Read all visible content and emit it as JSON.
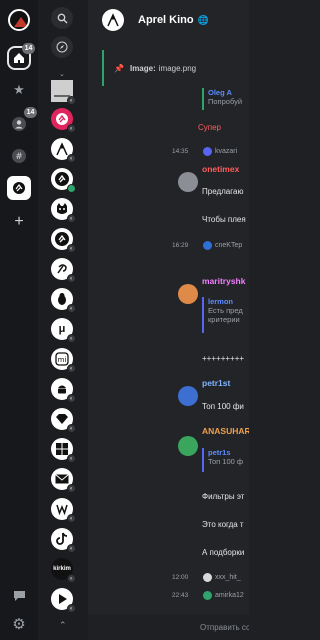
{
  "rail": {
    "badges": [
      "14",
      "14"
    ]
  },
  "channels": {
    "labels": [
      "μ",
      "kirkim"
    ]
  },
  "header": {
    "title": "Aprel Kino"
  },
  "pinned": {
    "label": "Image:",
    "value": "image.png"
  },
  "messages": {
    "quote1_name": "Oleg A",
    "quote1_text": "Попробуй",
    "super": "Супер",
    "r1_time": "14:35",
    "r1_user": "kvazari",
    "n1_name": "onetimex",
    "n1_l1": "Предлагаю",
    "n1_l2": "Чтобы плея",
    "r2_time": "16:29",
    "r2_user": "cneKTep",
    "n2_name": "maritryshk",
    "n2_q_name": "lermon",
    "n2_q_l1": "Есть пред",
    "n2_q_l2": "критерии",
    "n2_l1": "+++++++++",
    "n3_name": "petr1st",
    "n3_l1": "Топ 100 фи",
    "n4_name": "ANASUHAR",
    "n4_q_name": "petr1s",
    "n4_q_l1": "Топ 100 ф",
    "n4_l1": "Фильтры эт",
    "n4_l2": "Это когда т",
    "n4_l3": "А подборки",
    "r3_time": "12:00",
    "r3_user": "xxx_hit_",
    "r4_time": "22:43",
    "r4_user": "amirka12"
  },
  "composer": {
    "placeholder": "Отправить сооб"
  },
  "colors": {
    "accent_green": "#2ea36b",
    "red_name": "#ff5c5c",
    "pink_name": "#f47fff",
    "blue_name": "#7fb5ff",
    "orange_name": "#f0a04b",
    "link": "#5865f2"
  }
}
